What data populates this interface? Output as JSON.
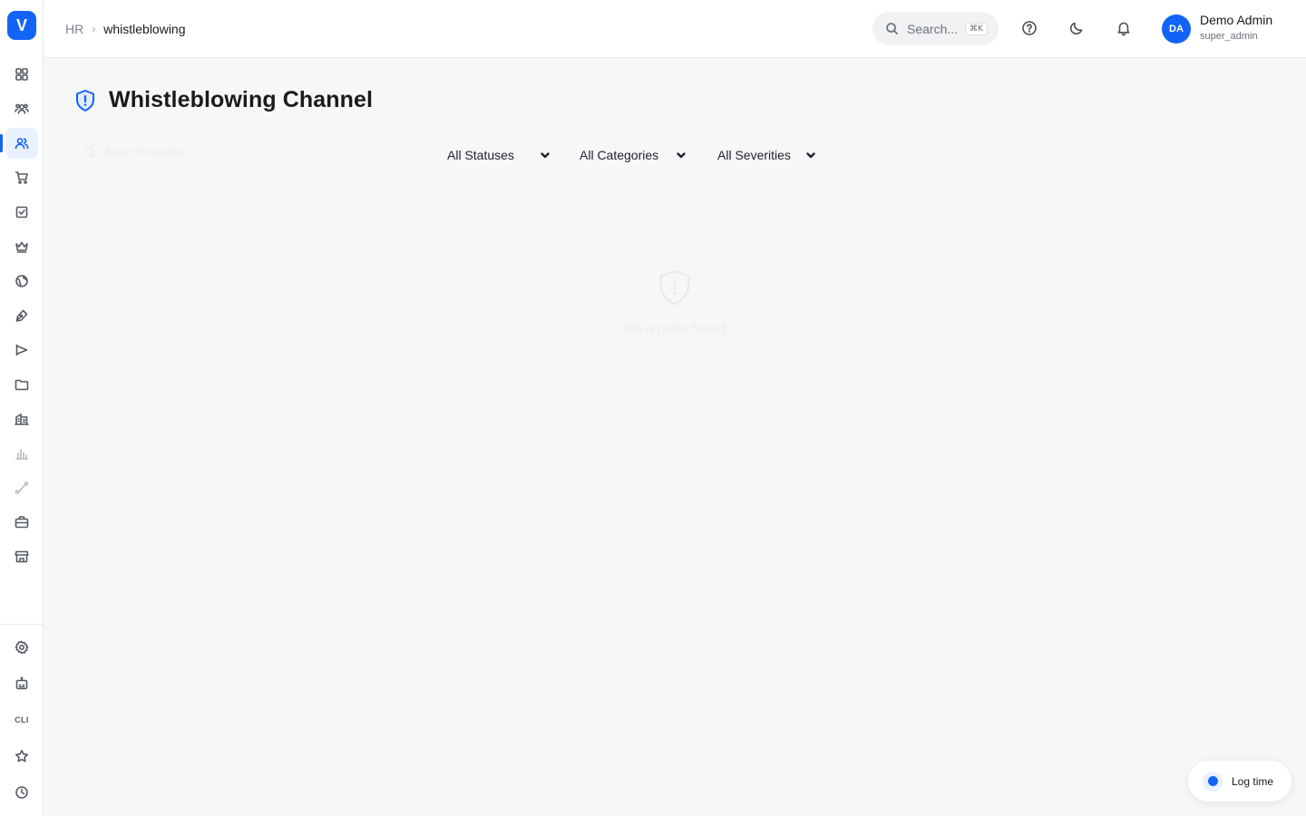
{
  "app": {
    "logo_letter": "V",
    "accent_color": "#1364f5"
  },
  "sidebar": {
    "items": [
      {
        "icon": "dashboard-grid-icon"
      },
      {
        "icon": "team-icon"
      },
      {
        "icon": "users-icon",
        "active": true
      },
      {
        "icon": "shopping-cart-icon"
      },
      {
        "icon": "checkbox-icon"
      },
      {
        "icon": "crown-icon"
      },
      {
        "icon": "globe-icon"
      },
      {
        "icon": "pen-tool-icon"
      },
      {
        "icon": "megaphone-icon"
      },
      {
        "icon": "folder-icon"
      },
      {
        "icon": "building-icon"
      },
      {
        "icon": "bar-chart-icon"
      },
      {
        "icon": "route-icon"
      },
      {
        "icon": "briefcase-icon"
      },
      {
        "icon": "store-icon"
      }
    ],
    "bottom_items": [
      {
        "icon": "gear-icon"
      },
      {
        "icon": "robot-icon"
      },
      {
        "icon": "cli-icon",
        "label": "CLI"
      },
      {
        "icon": "star-icon"
      },
      {
        "icon": "clock-icon"
      }
    ]
  },
  "header": {
    "breadcrumb": {
      "root": "HR",
      "current": "whistleblowing"
    },
    "search": {
      "placeholder": "Search...",
      "shortcut": "⌘K"
    },
    "user": {
      "initials": "DA",
      "name": "Demo Admin",
      "role": "super_admin"
    }
  },
  "page": {
    "title": "Whistleblowing Channel",
    "search_placeholder": "Search reports...",
    "filters": {
      "status": "All Statuses",
      "category": "All Categories",
      "severity": "All Severities"
    },
    "empty_state": "No reports found"
  },
  "log_time": {
    "label": "Log time"
  }
}
